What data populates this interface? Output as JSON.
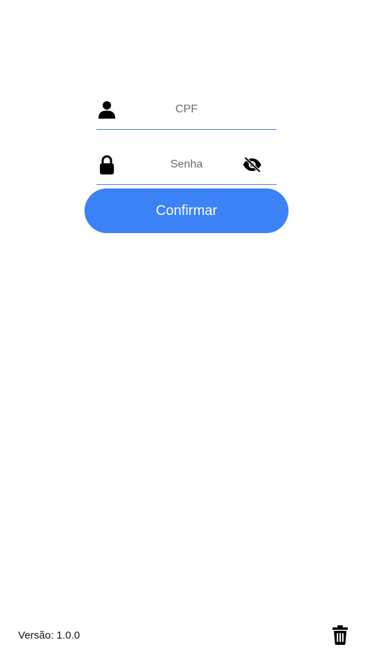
{
  "form": {
    "cpf": {
      "placeholder": "CPF",
      "value": "",
      "icon": "user-icon"
    },
    "senha": {
      "placeholder": "Senha",
      "value": "",
      "icon": "lock-icon",
      "toggle_icon": "eye-slash-icon"
    },
    "confirm_label": "Confirmar"
  },
  "footer": {
    "version_text": "Versão: 1.0.0",
    "delete_icon": "trash-icon"
  },
  "colors": {
    "accent": "#3b82f6",
    "button_text": "#ffffff",
    "icon": "#000000"
  }
}
